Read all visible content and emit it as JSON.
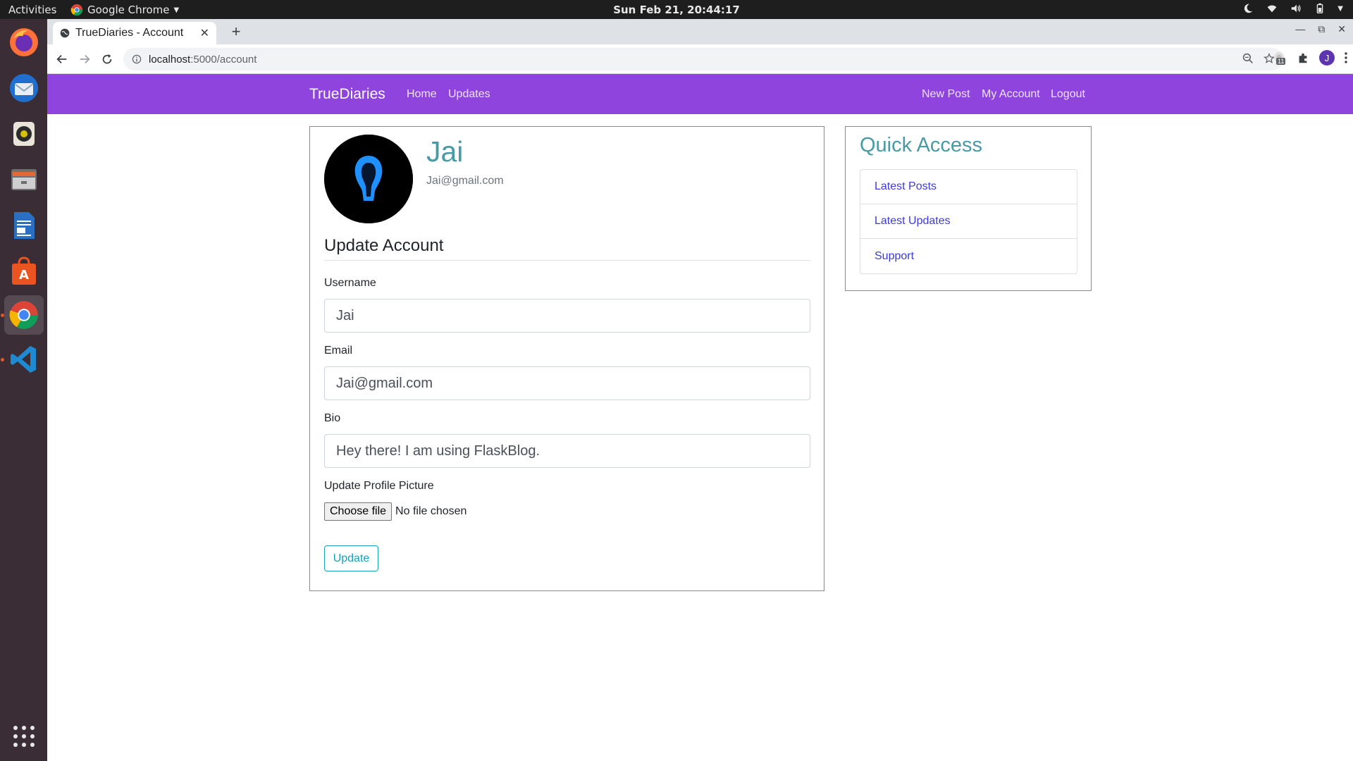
{
  "system": {
    "activities": "Activities",
    "app_menu": "Google Chrome",
    "clock": "Sun Feb 21, 20:44:17"
  },
  "dock": {
    "items": [
      "firefox-icon",
      "thunderbird-icon",
      "rhythmbox-icon",
      "files-icon",
      "libreoffice-writer-icon",
      "software-center-icon",
      "chrome-icon",
      "vscode-icon",
      "show-apps-icon"
    ]
  },
  "browser": {
    "tab_title": "TrueDiaries - Account",
    "url_host": "localhost",
    "url_path": ":5000/account",
    "profile_initial": "J",
    "extension_badge": "11"
  },
  "navbar": {
    "brand": "TrueDiaries",
    "left_links": [
      "Home",
      "Updates"
    ],
    "right_links": [
      "New Post",
      "My Account",
      "Logout"
    ],
    "color": "#8e44dd"
  },
  "profile": {
    "username": "Jai",
    "email": "Jai@gmail.com"
  },
  "form": {
    "legend": "Update Account",
    "username_label": "Username",
    "username_value": "Jai",
    "email_label": "Email",
    "email_value": "Jai@gmail.com",
    "bio_label": "Bio",
    "bio_value": "Hey there! I am using FlaskBlog.",
    "picture_label": "Update Profile Picture",
    "choose_file": "Choose file",
    "no_file": "No file chosen",
    "submit": "Update"
  },
  "sidebar": {
    "title": "Quick Access",
    "items": [
      "Latest Posts",
      "Latest Updates",
      "Support"
    ]
  }
}
